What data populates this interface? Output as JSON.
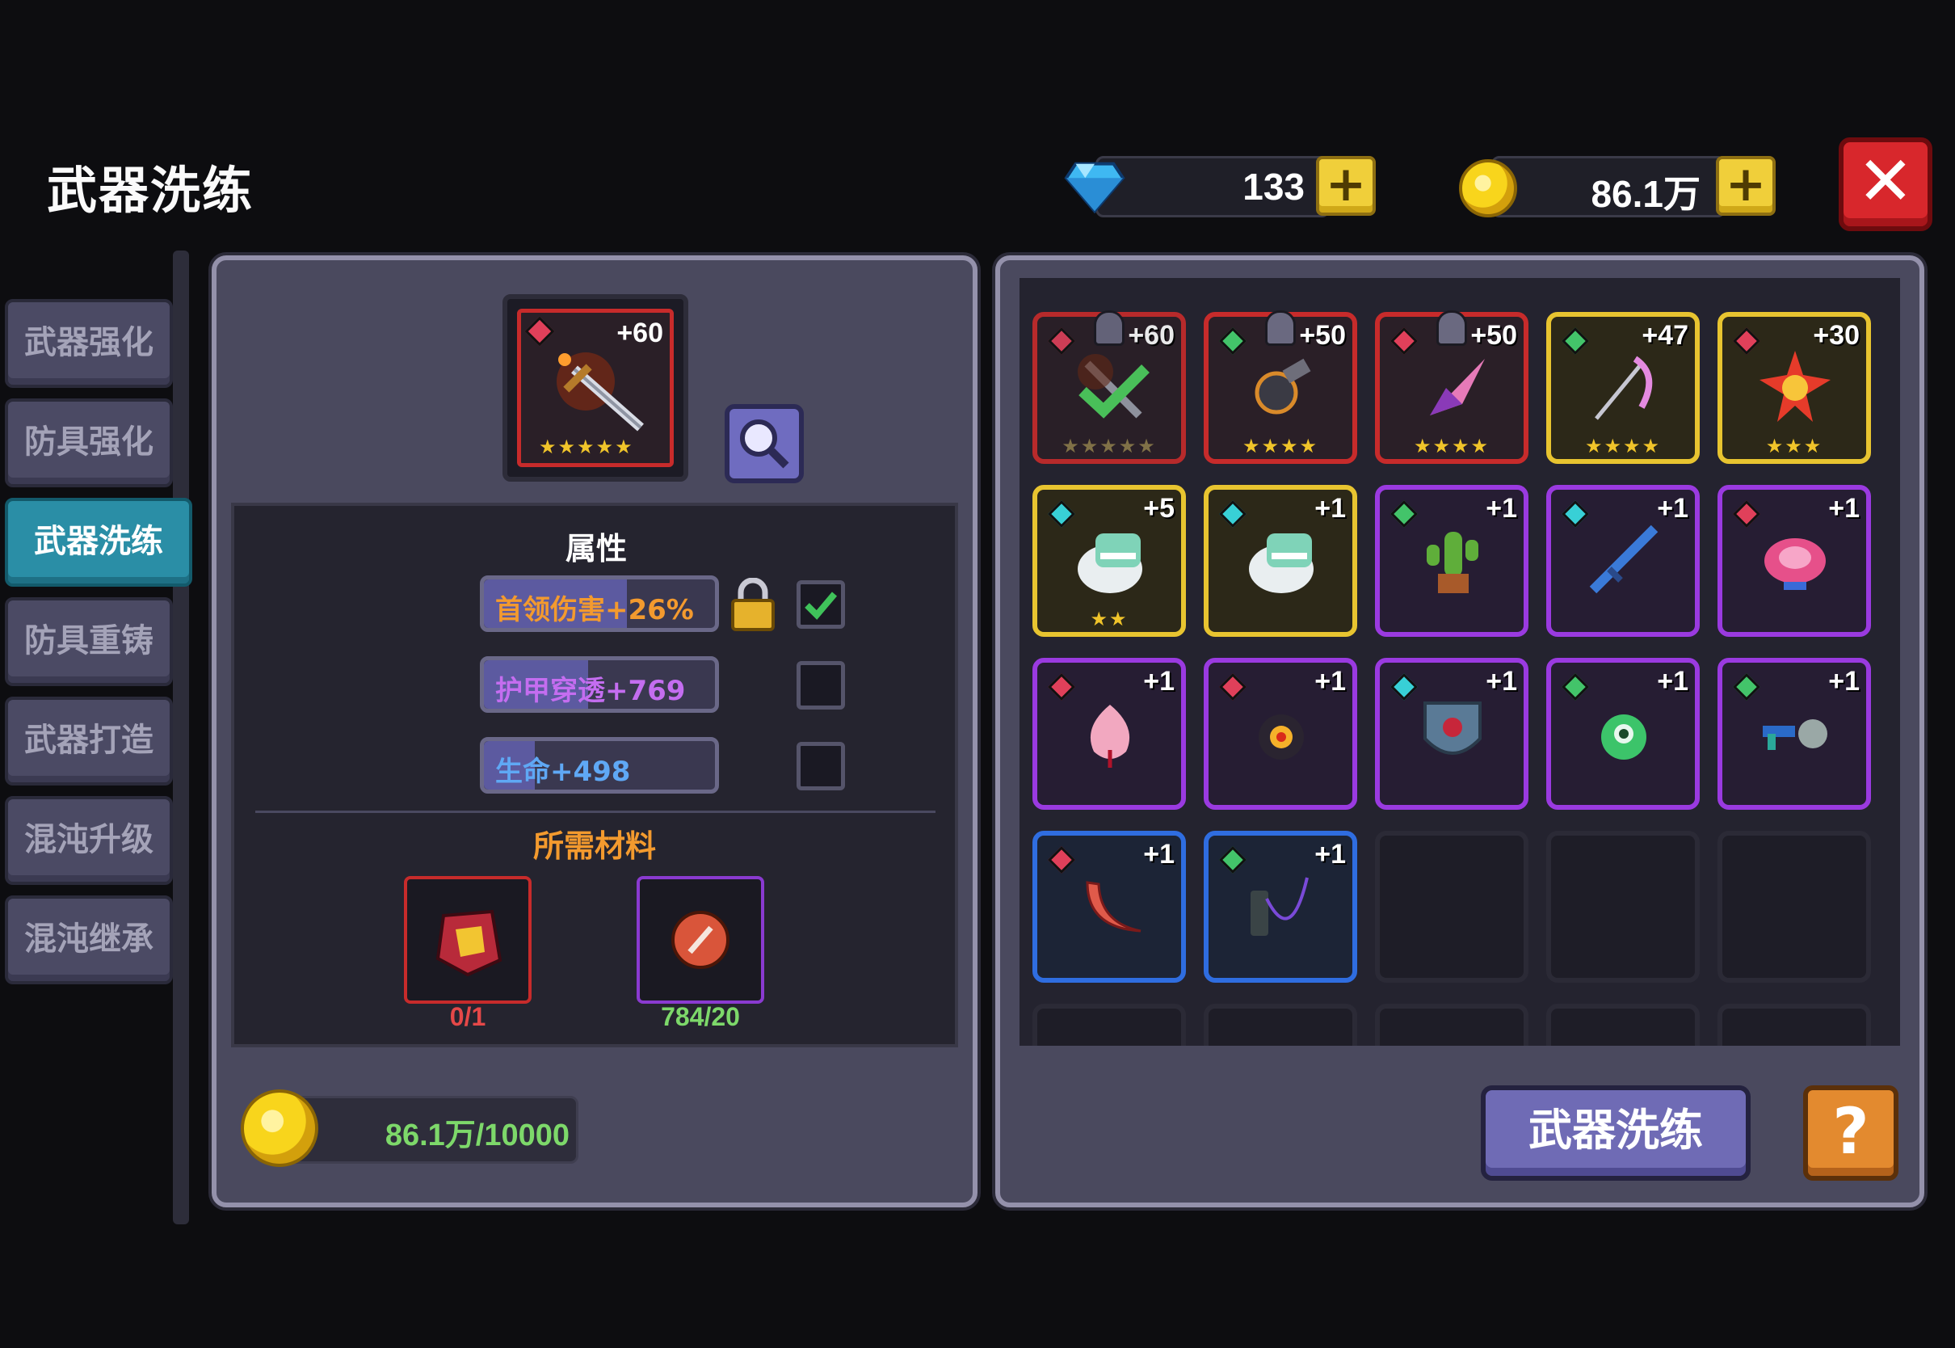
{
  "title": "武器洗练",
  "currency": {
    "gems": "133",
    "coins": "86.1万"
  },
  "tabs": [
    {
      "label": "武器强化",
      "active": false
    },
    {
      "label": "防具强化",
      "active": false
    },
    {
      "label": "武器洗练",
      "active": true
    },
    {
      "label": "防具重铸",
      "active": false
    },
    {
      "label": "武器打造",
      "active": false
    },
    {
      "label": "混沌升级",
      "active": false
    },
    {
      "label": "混沌继承",
      "active": false
    }
  ],
  "selected_item": {
    "level": "+60",
    "stars": "★★★★★",
    "gem_color": "#e0405a",
    "frame_color": "#c72b2b"
  },
  "attributes": {
    "title": "属性",
    "rows": [
      {
        "text": "首领伤害+26%",
        "color": "#f39a2e",
        "fill": 0.62,
        "fill_color": "#5c5aa0",
        "locked": true,
        "checked": true
      },
      {
        "text": "护甲穿透+769",
        "color": "#c46df0",
        "fill": 0.45,
        "fill_color": "#5c5aa0",
        "locked": false,
        "checked": false
      },
      {
        "text": "生命+498",
        "color": "#5fa8f5",
        "fill": 0.22,
        "fill_color": "#5c5aa0",
        "locked": false,
        "checked": false
      }
    ]
  },
  "materials": {
    "title": "所需材料",
    "items": [
      {
        "count": "0/1",
        "count_color": "#e54848",
        "border": "#c72b2b"
      },
      {
        "count": "784/20",
        "count_color": "#7dd86a",
        "border": "#8a3ad0"
      }
    ]
  },
  "cost": "86.1万/10000",
  "inventory": [
    {
      "level": "+60",
      "gem": "#e0405a",
      "frame": "#c72b2b",
      "stars": "★★★★★",
      "bell": true,
      "checked": true
    },
    {
      "level": "+50",
      "gem": "#43c46a",
      "frame": "#c72b2b",
      "stars": "★★★★",
      "bell": true
    },
    {
      "level": "+50",
      "gem": "#e0405a",
      "frame": "#c72b2b",
      "stars": "★★★★",
      "bell": true
    },
    {
      "level": "+47",
      "gem": "#43c46a",
      "frame": "#e8c430",
      "stars": "★★★★"
    },
    {
      "level": "+30",
      "gem": "#e0405a",
      "frame": "#e8c430",
      "stars": "★★★"
    },
    {
      "level": "+5",
      "gem": "#38d0d6",
      "frame": "#e8c430",
      "stars": "★★"
    },
    {
      "level": "+1",
      "gem": "#38d0d6",
      "frame": "#e8c430",
      "stars": ""
    },
    {
      "level": "+1",
      "gem": "#43c46a",
      "frame": "#9a3ae0",
      "stars": ""
    },
    {
      "level": "+1",
      "gem": "#38d0d6",
      "frame": "#9a3ae0",
      "stars": ""
    },
    {
      "level": "+1",
      "gem": "#e0405a",
      "frame": "#9a3ae0",
      "stars": ""
    },
    {
      "level": "+1",
      "gem": "#e0405a",
      "frame": "#9a3ae0",
      "stars": ""
    },
    {
      "level": "+1",
      "gem": "#e0405a",
      "frame": "#9a3ae0",
      "stars": ""
    },
    {
      "level": "+1",
      "gem": "#38d0d6",
      "frame": "#9a3ae0",
      "stars": ""
    },
    {
      "level": "+1",
      "gem": "#43c46a",
      "frame": "#9a3ae0",
      "stars": ""
    },
    {
      "level": "+1",
      "gem": "#43c46a",
      "frame": "#9a3ae0",
      "stars": ""
    },
    {
      "level": "+1",
      "gem": "#e0405a",
      "frame": "#2f6de0",
      "stars": ""
    },
    {
      "level": "+1",
      "gem": "#43c46a",
      "frame": "#2f6de0",
      "stars": ""
    }
  ],
  "action_button": "武器洗练",
  "help_button": "?",
  "colors": {
    "accent_tab": "#2a8ea6",
    "panel": "#4a495e",
    "button": "#6f6bb5"
  }
}
